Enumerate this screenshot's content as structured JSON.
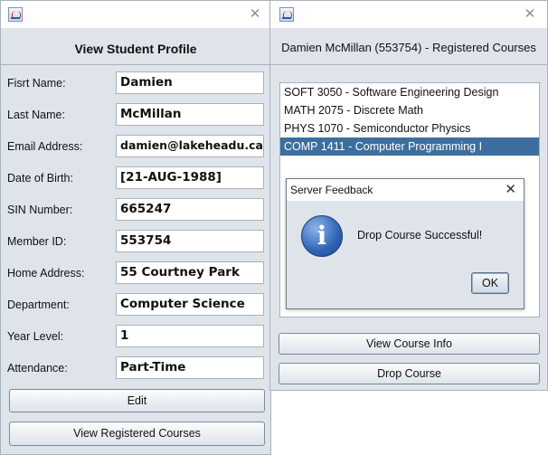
{
  "profile_window": {
    "title": "View Student Profile",
    "fields": [
      {
        "label": "Fisrt Name:",
        "value": "Damien"
      },
      {
        "label": "Last Name:",
        "value": "McMillan"
      },
      {
        "label": "Email Address:",
        "value": "damien@lakeheadu.ca"
      },
      {
        "label": "Date of Birth:",
        "value": "[21-AUG-1988]"
      },
      {
        "label": "SIN Number:",
        "value": "665247"
      },
      {
        "label": "Member ID:",
        "value": "553754"
      },
      {
        "label": "Home Address:",
        "value": "55 Courtney Park"
      },
      {
        "label": "Department:",
        "value": "Computer Science"
      },
      {
        "label": "Year Level:",
        "value": "1"
      },
      {
        "label": "Attendance:",
        "value": "Part-Time"
      }
    ],
    "edit_button": "Edit",
    "view_courses_button": "View Registered Courses"
  },
  "courses_window": {
    "title": "Damien McMillan (553754) - Registered Courses",
    "courses": [
      "SOFT 3050 - Software Engineering Design",
      "MATH 2075 - Discrete Math",
      "PHYS 1070 - Semiconductor Physics",
      "COMP 1411 - Computer Programming I"
    ],
    "selected_course": "COMP 1411 - Computer Programming I",
    "view_info_button": "View Course Info",
    "drop_button": "Drop Course"
  },
  "dialog": {
    "title": "Server Feedback",
    "message": "Drop Course Successful!",
    "ok_button": "OK",
    "icon": "info-icon"
  },
  "colors": {
    "window_bg": "#dfe4ea",
    "selection": "#3d6f9e",
    "border": "#a9b3bd"
  },
  "icons": {
    "app": "java-app-icon",
    "close": "close-icon"
  }
}
